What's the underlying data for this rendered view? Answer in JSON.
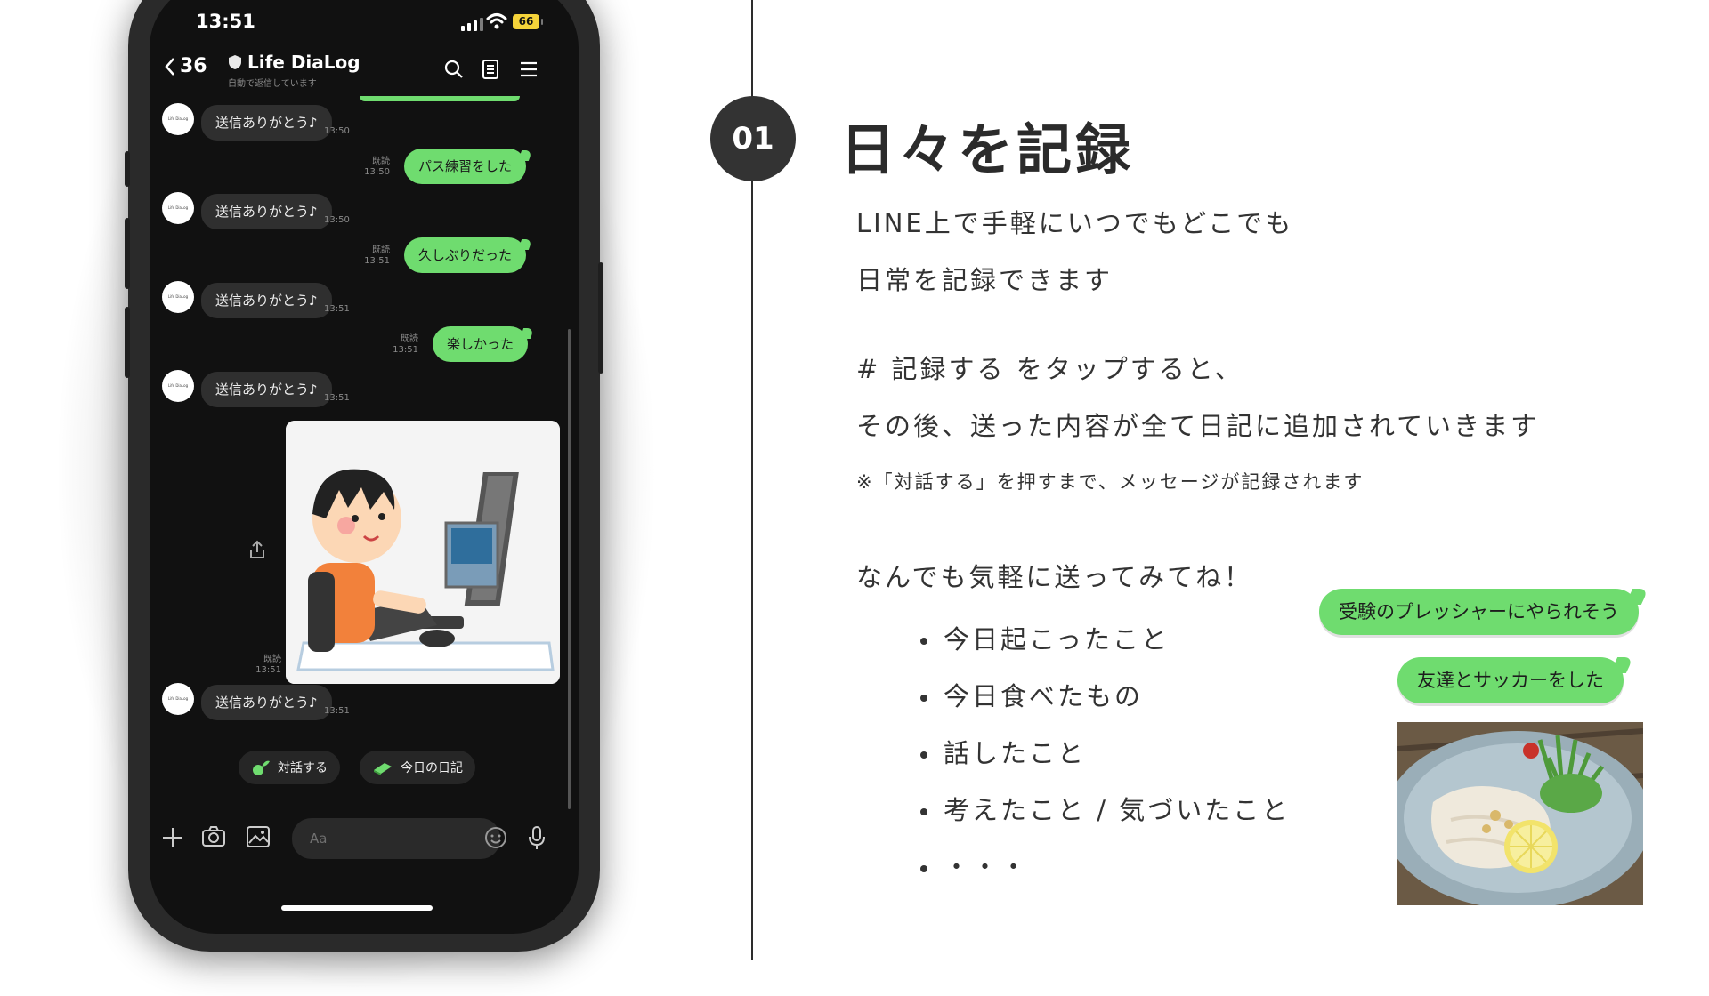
{
  "phone": {
    "status": {
      "time": "13:51",
      "battery": "66"
    },
    "header": {
      "back_count": "36",
      "title": "Life DiaLog",
      "subtitle": "自動で返信しています"
    },
    "avatar_label": "Life DiaLog",
    "messages": [
      {
        "dir": "in",
        "text": "送信ありがとう♪",
        "time": "13:50"
      },
      {
        "dir": "out",
        "text": "パス練習をした",
        "read": "既読",
        "time": "13:50"
      },
      {
        "dir": "in",
        "text": "送信ありがとう♪",
        "time": "13:50"
      },
      {
        "dir": "out",
        "text": "久しぶりだった",
        "read": "既読",
        "time": "13:51"
      },
      {
        "dir": "in",
        "text": "送信ありがとう♪",
        "time": "13:51"
      },
      {
        "dir": "out",
        "text": "楽しかった",
        "read": "既読",
        "time": "13:51"
      },
      {
        "dir": "in",
        "text": "送信ありがとう♪",
        "time": "13:51"
      },
      {
        "dir": "out-image",
        "read": "既読",
        "time": "13:51"
      },
      {
        "dir": "in",
        "text": "送信ありがとう♪",
        "time": "13:51"
      }
    ],
    "quick_replies": [
      {
        "label": "対話する",
        "icon": "sprout-icon"
      },
      {
        "label": "今日の日記",
        "icon": "book-icon"
      }
    ],
    "input": {
      "placeholder": "Aa"
    }
  },
  "slide": {
    "number": "01",
    "heading": "日々を記録",
    "lines": [
      "LINE上で手軽にいつでもどこでも",
      "日常を記録できます",
      "# 記録する をタップすると、",
      "その後、送った内容が全て日記に追加されていきます"
    ],
    "note": "※「対話する」を押すまで、メッセージが記録されます",
    "prompt": "なんでも気軽に送ってみてね！",
    "bullets": [
      "今日起こったこと",
      "今日食べたもの",
      "話したこと",
      "考えたこと / 気づいたこと",
      "・・・"
    ],
    "sample_messages": [
      "受験のプレッシャーにやられそう",
      "友達とサッカーをした"
    ]
  },
  "colors": {
    "line_green": "#6fdc6f",
    "dark_bg": "#111111",
    "text": "#2b2b2b"
  }
}
